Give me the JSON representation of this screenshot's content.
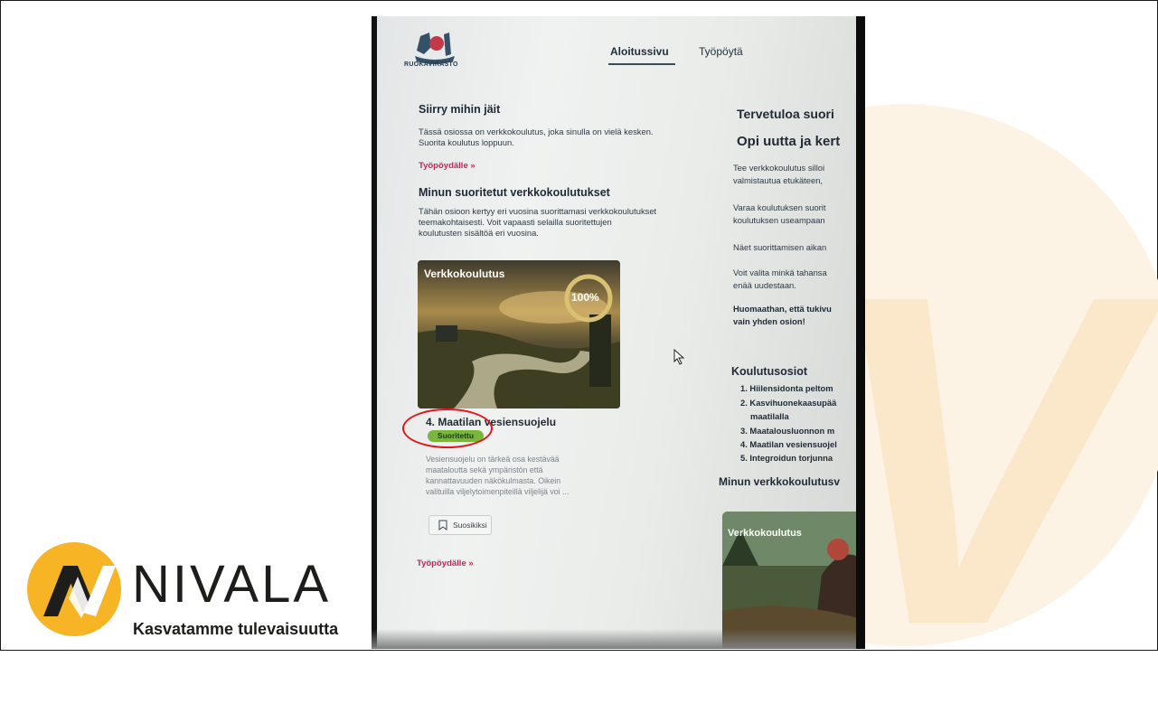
{
  "branding": {
    "name": "NIVALA",
    "tagline": "Kasvatamme tulevaisuutta",
    "colors": {
      "yellow": "#f7b425",
      "dark": "#1d1d1b",
      "cream": "#fdf3e4"
    }
  },
  "screen": {
    "logo_text": "RUOKAVIRASTO",
    "nav": {
      "home": "Aloitussivu",
      "dashboard": "Työpöytä"
    },
    "left": {
      "continue_title": "Siirry mihin jäit",
      "continue_text_1": "Tässä osiossa on verkkokoulutus, joka sinulla on vielä kesken.",
      "continue_text_2": "Suorita koulutus loppuun.",
      "dashboard_link": "Työpöydälle »",
      "completed_title": "Minun suoritetut verkkokoulutukset",
      "completed_text_1": "Tähän osioon kertyy eri vuosina suorittamasi verkkokoulutukset",
      "completed_text_2": "teemakohtaisesti. Voit vapaasti selailla suoritettujen",
      "completed_text_3": "koulutusten sisältöä eri vuosina.",
      "card": {
        "tag": "Verkkokoulutus",
        "progress": "100%",
        "progress_value": 100,
        "title": "4. Maatilan vesiensuojelu",
        "status": "Suoritettu",
        "desc_1": "Vesiensuojelu on tärkeä osa kestävää",
        "desc_2": "maataloutta sekä ympäristön että",
        "desc_3": "kannattavuuden näkökulmasta. Oikein",
        "desc_4": "valituilla viljelytoimenpiteillä viljelijä voi ...",
        "favorite": "Suosikiksi"
      },
      "dashboard_link_2": "Työpöydälle »"
    },
    "right": {
      "welcome": "Tervetuloa suori",
      "learn": "Opi uutta ja kert",
      "p1_1": "Tee verkkokoulutus silloi",
      "p1_2": "valmistautua etukäteen,",
      "p2_1": "Varaa koulutuksen suorit",
      "p2_2": "koulutuksen useampaan",
      "p3": "Näet suorittamisen aikan",
      "p4_1": "Voit valita minkä tahansa",
      "p4_2": "enää uudestaan.",
      "note_1": "Huomaathan, että tukivu",
      "note_2": "vain yhden osion!",
      "modules_title": "Koulutusosiot",
      "modules": [
        "1. Hiilensidonta peltom",
        "2. Kasvihuonekaasupää",
        "maatilalla",
        "3. Maatalousluonnon m",
        "4. Maatilan vesiensuojel",
        "5. Integroidun torjunna"
      ],
      "my_courses": "Minun verkkokoulutusv",
      "card2_tag": "Verkkokoulutus"
    }
  }
}
